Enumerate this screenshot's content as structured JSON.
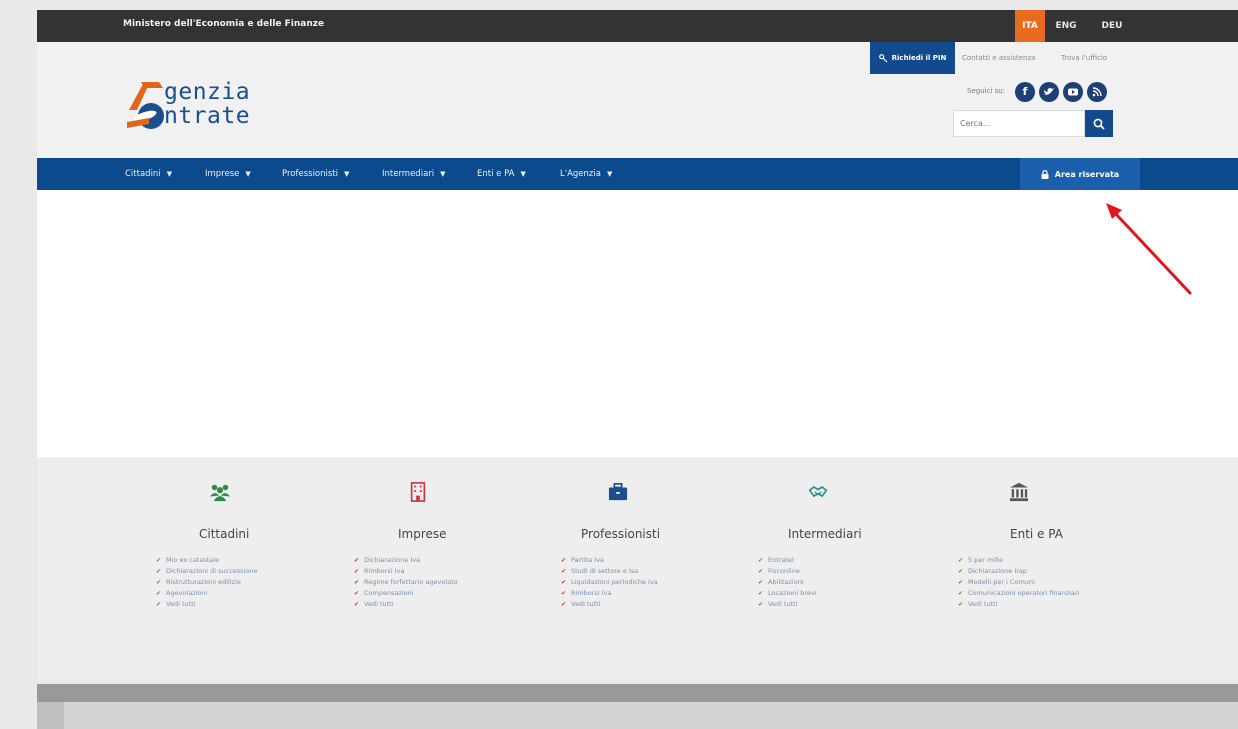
{
  "topbar": {
    "ministry": "Ministero dell'Economia e delle Finanze",
    "languages": [
      "ITA",
      "ENG",
      "DEU"
    ]
  },
  "header": {
    "logo_line1": "genzia",
    "logo_line2": "ntrate",
    "pin_button": "Richiedi il PIN",
    "contatti": "Contatti e assistenza",
    "trova_ufficio": "Trova l'ufficio",
    "seguici": "Seguici su:",
    "search_placeholder": "Cerca..."
  },
  "nav": {
    "items": [
      "Cittadini",
      "Imprese",
      "Professionisti",
      "Intermediari",
      "Enti e PA",
      "L'Agenzia"
    ],
    "area_riservata": "Area riservata"
  },
  "footer": {
    "categories": [
      {
        "title": "Cittadini",
        "links": [
          "Mio ex catastale",
          "Dichiarazioni di successione",
          "Ristrutturazioni edilizie",
          "Agevolazioni",
          "Vedi tutti"
        ]
      },
      {
        "title": "Imprese",
        "links": [
          "Dichiarazione Iva",
          "Rimborsi Iva",
          "Regime forfettario agevolato",
          "Compensazioni",
          "Vedi tutti"
        ]
      },
      {
        "title": "Professionisti",
        "links": [
          "Partita Iva",
          "Studi di settore e Isa",
          "Liquidazioni periodiche Iva",
          "Rimborsi Iva",
          "Vedi tutti"
        ]
      },
      {
        "title": "Intermediari",
        "links": [
          "Entratel",
          "Fisconline",
          "Abilitazioni",
          "Locazioni brevi",
          "Vedi tutti"
        ]
      },
      {
        "title": "Enti e PA",
        "links": [
          "5 per mille",
          "Dichiarazione Irap",
          "Modelli per i Comuni",
          "Comunicazioni operatori finanziari",
          "Vedi tutti"
        ]
      }
    ]
  },
  "colors": {
    "nav_blue": "#0c4a8e",
    "accent_orange": "#e86b1f",
    "topbar": "#333333",
    "annotation_red": "#e0161e"
  }
}
